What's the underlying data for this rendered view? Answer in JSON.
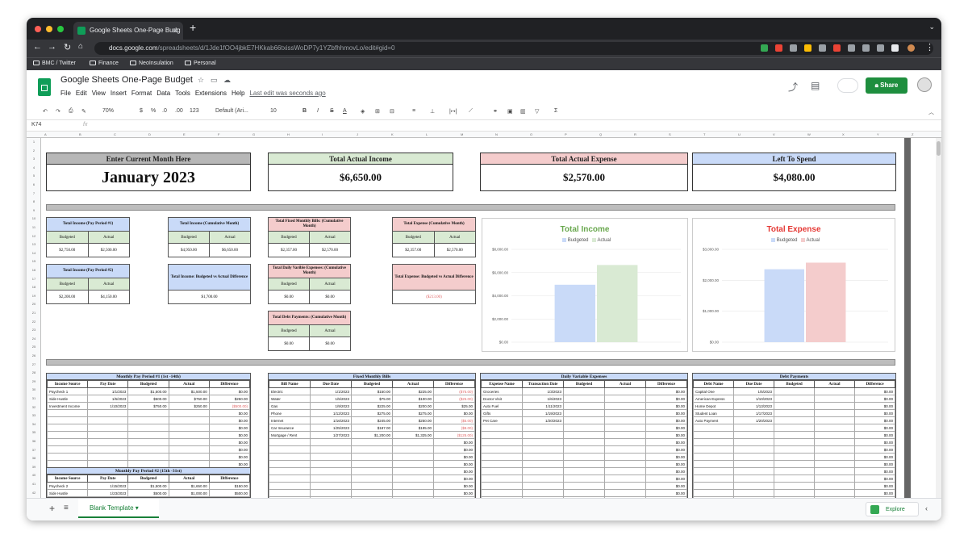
{
  "browser": {
    "tab_title": "Google Sheets One-Page Budg",
    "url_host": "docs.google.com",
    "url_path": "/spreadsheets/d/1Jde1fOO4jbkE7HKkab66txissWoDP7y1YZbfhhmovLo/edit#gid=0",
    "bookmarks": [
      "BMC / Twitter",
      "Finance",
      "NeoInsulation",
      "Personal"
    ]
  },
  "app": {
    "title": "Google Sheets One-Page Budget",
    "menus": [
      "File",
      "Edit",
      "View",
      "Insert",
      "Format",
      "Data",
      "Tools",
      "Extensions",
      "Help"
    ],
    "last_edit": "Last edit was seconds ago",
    "share_label": "Share"
  },
  "toolbar": {
    "zoom": "70%",
    "currency": "$",
    "percent": "%",
    "dec_less": ".0",
    "dec_more": ".00",
    "format": "123",
    "font": "Default (Ari...",
    "size": "10",
    "bold": "B",
    "italic": "I",
    "strike": "S",
    "color": "A"
  },
  "formula_bar": {
    "cell_ref": "K74",
    "fx": "fx"
  },
  "summary": {
    "month_label": "Enter Current Month Here",
    "month_value": "January 2023",
    "income_label": "Total Actual Income",
    "income_value": "$6,650.00",
    "expense_label": "Total Actual Expense",
    "expense_value": "$2,570.00",
    "left_label": "Left To Spend",
    "left_value": "$4,080.00"
  },
  "metrics": {
    "pp1": {
      "title": "Total Income (Pay Period #1)",
      "budgeted": "$2,750.00",
      "actual": "$2,500.00"
    },
    "pp2": {
      "title": "Total Income (Pay Period #2)",
      "budgeted": "$2,200.00",
      "actual": "$4,150.00"
    },
    "cum": {
      "title": "Total Income (Cumulative Month)",
      "budgeted": "$4,950.00",
      "actual": "$6,650.00"
    },
    "diff": {
      "title": "Total Income: Budgeted vs Actual Difference",
      "value": "$1,700.00"
    },
    "fixed": {
      "title": "Total Fixed Monthly Bills: (Cumulative Month)",
      "budgeted": "$2,357.00",
      "actual": "$2,570.00"
    },
    "daily": {
      "title": "Total Daily Varible Expenses: (Cumulative Month)",
      "budgeted": "$0.00",
      "actual": "$0.00"
    },
    "debt": {
      "title": "Total Debt Payments: (Cumulative Month)",
      "budgeted": "$0.00",
      "actual": "$0.00"
    },
    "expcum": {
      "title": "Total Expense (Cumulative Month)",
      "budgeted": "$2,357.00",
      "actual": "$2,570.00"
    },
    "expdiff": {
      "title": "Total Expense: Budgeted vs Actual Difference",
      "value": "($213.00)"
    },
    "hdr_budgeted": "Budgeted",
    "hdr_actual": "Actual"
  },
  "chart_data": [
    {
      "type": "bar",
      "title": "Total Income",
      "series": [
        {
          "name": "Budgeted",
          "values": [
            4950
          ]
        },
        {
          "name": "Actual",
          "values": [
            6650
          ]
        }
      ],
      "yticks": [
        "$8,000.00",
        "$6,000.00",
        "$4,000.00",
        "$2,000.00",
        "$0.00"
      ],
      "ylim": [
        0,
        8000
      ],
      "colors": [
        "#c9daf8",
        "#d9ead3"
      ],
      "title_color": "#6aa84f",
      "legend": "top"
    },
    {
      "type": "bar",
      "title": "Total Expense",
      "series": [
        {
          "name": "Budgeted",
          "values": [
            2357
          ]
        },
        {
          "name": "Actual",
          "values": [
            2570
          ]
        }
      ],
      "yticks": [
        "$3,000.00",
        "$2,000.00",
        "$1,000.00",
        "$0.00"
      ],
      "ylim": [
        0,
        3000
      ],
      "colors": [
        "#c9daf8",
        "#f4cccc"
      ],
      "title_color": "#e53935",
      "legend": "top"
    }
  ],
  "tables": {
    "pp1": {
      "title": "Monthly Pay Period #1 (1st -14th)",
      "headers": [
        "Income Source",
        "Pay Date",
        "Budgeted",
        "Actual",
        "Difference"
      ],
      "rows": [
        [
          "Paycheck 1",
          "1/1/2023",
          "$1,500.00",
          "$1,500.00",
          "$0.00"
        ],
        [
          "Side Hustle",
          "1/6/2023",
          "$500.00",
          "$750.00",
          "$250.00"
        ],
        [
          "Investment Income",
          "1/10/2023",
          "$750.00",
          "$250.00",
          "($500.00)"
        ],
        [
          "",
          "",
          "",
          "",
          "$0.00"
        ],
        [
          "",
          "",
          "",
          "",
          "$0.00"
        ],
        [
          "",
          "",
          "",
          "",
          "$0.00"
        ],
        [
          "",
          "",
          "",
          "",
          "$0.00"
        ],
        [
          "",
          "",
          "",
          "",
          "$0.00"
        ],
        [
          "",
          "",
          "",
          "",
          "$0.00"
        ],
        [
          "",
          "",
          "",
          "",
          "$0.00"
        ],
        [
          "",
          "",
          "",
          "",
          "$0.00"
        ]
      ]
    },
    "pp2": {
      "title": "Monthly Pay Period #2 (15th -31st)",
      "headers": [
        "Income Source",
        "Pay Date",
        "Budgeted",
        "Actual",
        "Difference"
      ],
      "rows": [
        [
          "Paycheck 2",
          "1/15/2023",
          "$1,500.00",
          "$1,650.00",
          "$150.00"
        ],
        [
          "Side Hustle",
          "1/23/2023",
          "$500.00",
          "$1,000.00",
          "$500.00"
        ]
      ]
    },
    "fixed": {
      "title": "Fixed Monthly Bills",
      "headers": [
        "Bill Name",
        "Due Date",
        "Budgeted",
        "Actual",
        "Difference"
      ],
      "rows": [
        [
          "Electric",
          "1/1/2023",
          "$150.00",
          "$225.00",
          "($75.00)"
        ],
        [
          "Water",
          "1/5/2023",
          "$75.00",
          "$100.00",
          "($25.00)"
        ],
        [
          "Gas",
          "1/9/2023",
          "$225.00",
          "$200.00",
          "$25.00"
        ],
        [
          "Phone",
          "1/12/2023",
          "$275.00",
          "$275.00",
          "$0.00"
        ],
        [
          "Internet",
          "1/16/2023",
          "$245.00",
          "$250.00",
          "($5.00)"
        ],
        [
          "Car Insurance",
          "1/25/2023",
          "$187.00",
          "$195.00",
          "($8.00)"
        ],
        [
          "Mortgage / Rent",
          "1/27/2023",
          "$1,200.00",
          "$1,325.00",
          "($125.00)"
        ],
        [
          "",
          "",
          "",
          "",
          "$0.00"
        ],
        [
          "",
          "",
          "",
          "",
          "$0.00"
        ],
        [
          "",
          "",
          "",
          "",
          "$0.00"
        ],
        [
          "",
          "",
          "",
          "",
          "$0.00"
        ],
        [
          "",
          "",
          "",
          "",
          "$0.00"
        ],
        [
          "",
          "",
          "",
          "",
          "$0.00"
        ],
        [
          "",
          "",
          "",
          "",
          "$0.00"
        ],
        [
          "",
          "",
          "",
          "",
          "$0.00"
        ],
        [
          "",
          "",
          "",
          "",
          "$0.00"
        ]
      ]
    },
    "daily": {
      "title": "Daily Variable Expenses",
      "headers": [
        "Expense Name",
        "Transaction Date",
        "Budgeted",
        "Actual",
        "Difference"
      ],
      "rows": [
        [
          "Groceries",
          "1/3/2023",
          "",
          "",
          "$0.00"
        ],
        [
          "Doctor Visit",
          "1/6/2023",
          "",
          "",
          "$0.00"
        ],
        [
          "Auto Fuel",
          "1/11/2023",
          "",
          "",
          "$0.00"
        ],
        [
          "Gifts",
          "1/19/2023",
          "",
          "",
          "$0.00"
        ],
        [
          "Pet Care",
          "1/20/2023",
          "",
          "",
          "$0.00"
        ],
        [
          "",
          "",
          "",
          "",
          "$0.00"
        ],
        [
          "",
          "",
          "",
          "",
          "$0.00"
        ],
        [
          "",
          "",
          "",
          "",
          "$0.00"
        ],
        [
          "",
          "",
          "",
          "",
          "$0.00"
        ],
        [
          "",
          "",
          "",
          "",
          "$0.00"
        ],
        [
          "",
          "",
          "",
          "",
          "$0.00"
        ],
        [
          "",
          "",
          "",
          "",
          "$0.00"
        ],
        [
          "",
          "",
          "",
          "",
          "$0.00"
        ],
        [
          "",
          "",
          "",
          "",
          "$0.00"
        ],
        [
          "",
          "",
          "",
          "",
          "$0.00"
        ],
        [
          "",
          "",
          "",
          "",
          "$0.00"
        ]
      ]
    },
    "debt": {
      "title": "Debt Payments",
      "headers": [
        "Debt Name",
        "Due Date",
        "Budgeted",
        "Actual",
        "Difference"
      ],
      "rows": [
        [
          "Capital One",
          "1/5/2023",
          "",
          "",
          "$0.00"
        ],
        [
          "American Express",
          "1/10/2023",
          "",
          "",
          "$0.00"
        ],
        [
          "Home Depot",
          "1/13/2023",
          "",
          "",
          "$0.00"
        ],
        [
          "Student Loan",
          "1/17/2023",
          "",
          "",
          "$0.00"
        ],
        [
          "Auto Payment",
          "1/20/2023",
          "",
          "",
          "$0.00"
        ],
        [
          "",
          "",
          "",
          "",
          "$0.00"
        ],
        [
          "",
          "",
          "",
          "",
          "$0.00"
        ],
        [
          "",
          "",
          "",
          "",
          "$0.00"
        ],
        [
          "",
          "",
          "",
          "",
          "$0.00"
        ],
        [
          "",
          "",
          "",
          "",
          "$0.00"
        ],
        [
          "",
          "",
          "",
          "",
          "$0.00"
        ],
        [
          "",
          "",
          "",
          "",
          "$0.00"
        ],
        [
          "",
          "",
          "",
          "",
          "$0.00"
        ],
        [
          "",
          "",
          "",
          "",
          "$0.00"
        ],
        [
          "",
          "",
          "",
          "",
          "$0.00"
        ],
        [
          "",
          "",
          "",
          "",
          "$0.00"
        ]
      ]
    }
  },
  "bottom": {
    "sheet_tab": "Blank Template",
    "explore": "Explore"
  }
}
